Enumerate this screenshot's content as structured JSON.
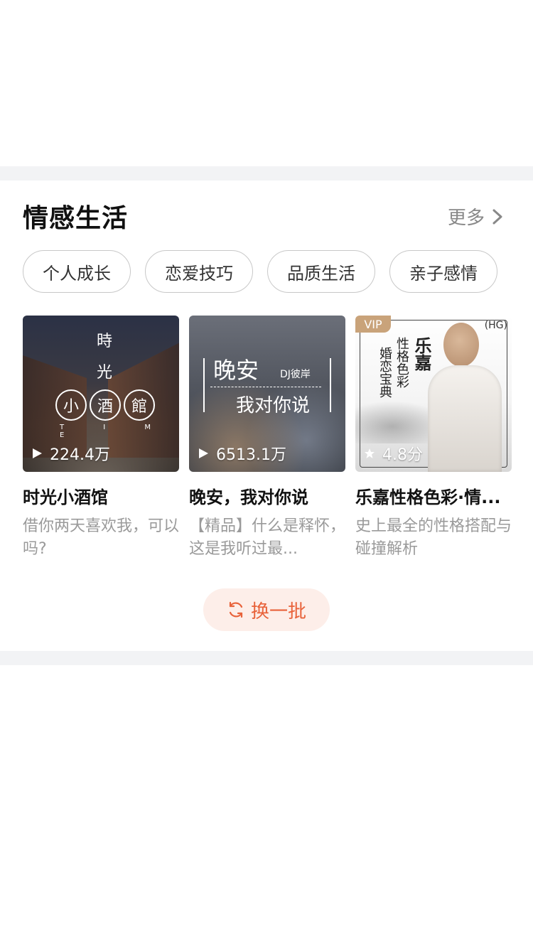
{
  "section": {
    "title": "情感生活",
    "more_label": "更多"
  },
  "tags": [
    "个人成长",
    "恋爱技巧",
    "品质生活",
    "亲子感情"
  ],
  "cards": [
    {
      "title": "时光小酒馆",
      "description": "借你两天喜欢我，可以吗?",
      "stat": "224.4万",
      "stat_icon": "play-icon",
      "cover": {
        "vertical_top": "時",
        "vertical_mid": "光",
        "circles": [
          "小",
          "酒",
          "館"
        ],
        "subtitle": "T I M E"
      }
    },
    {
      "title": "晚安，我对你说",
      "description": "【精品】什么是释怀，这是我听过最...",
      "stat": "6513.1万",
      "stat_icon": "play-icon",
      "cover": {
        "line1": "晚安",
        "author": "DJ彼岸",
        "line2": "我对你说"
      }
    },
    {
      "title": "乐嘉性格色彩·情...",
      "description": "史上最全的性格搭配与碰撞解析",
      "stat": "4.8分",
      "stat_icon": "star-icon",
      "cover": {
        "badge": "VIP",
        "name": "乐嘉",
        "text1": "性格色彩",
        "text2": "婚恋宝典",
        "logo": "(HG)"
      }
    }
  ],
  "refresh_label": "换一批",
  "colors": {
    "accent": "#e8623a",
    "accent_bg": "#fdeee9",
    "divider": "#f2f3f5",
    "vip": "#c9a37a"
  }
}
